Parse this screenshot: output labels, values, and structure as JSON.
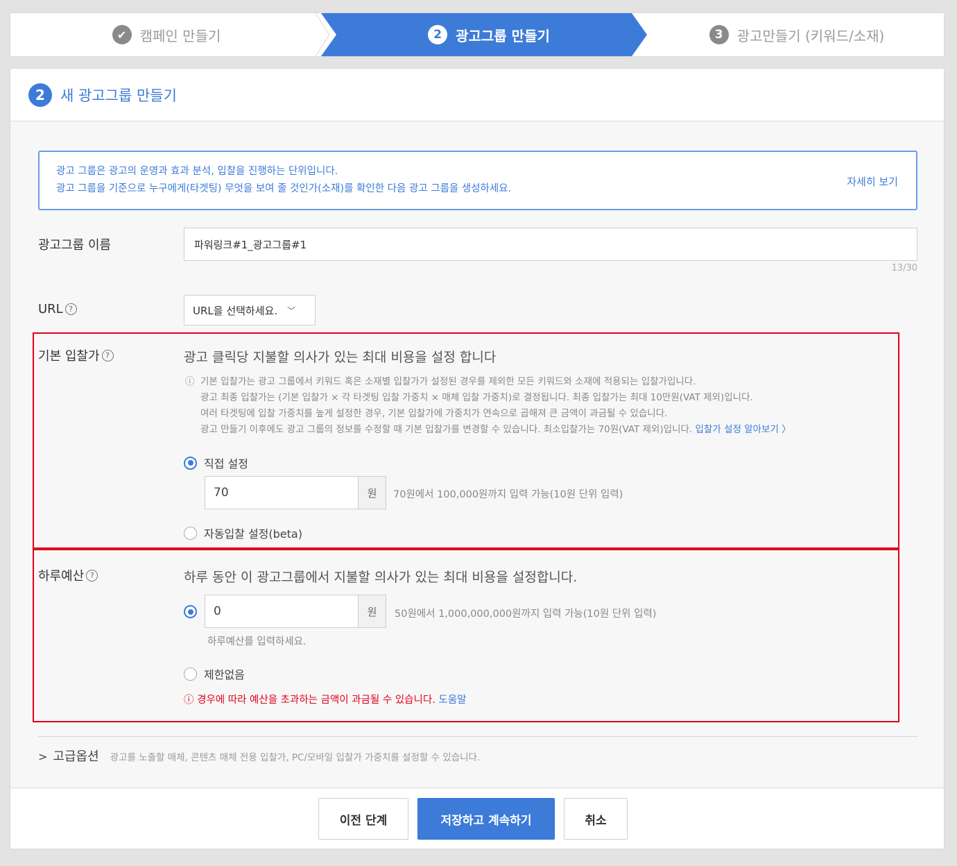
{
  "stepper": {
    "step1": {
      "label": "캠페인 만들기",
      "icon": "check-icon"
    },
    "step2": {
      "number": "2",
      "label": "광고그룹 만들기"
    },
    "step3": {
      "number": "3",
      "label": "광고만들기 (키워드/소재)"
    }
  },
  "panel": {
    "step_number": "2",
    "title": "새 광고그룹 만들기"
  },
  "info": {
    "line1": "광고 그룹은 광고의 운영과 효과 분석, 입찰을 진행하는 단위입니다.",
    "line2": "광고 그룹을 기준으로 누구에게(타겟팅) 무엇을 보여 줄 것인가(소재)를 확인한 다음 광고 그룹을 생성하세요.",
    "more_link": "자세히 보기"
  },
  "adgroup_name": {
    "label": "광고그룹 이름",
    "value": "파워링크#1_광고그룹#1",
    "counter": "13/30"
  },
  "url": {
    "label": "URL",
    "help_icon": "?",
    "select_value": "URL을 선택하세요."
  },
  "base_bid": {
    "label": "기본 입찰가",
    "help_icon": "?",
    "description": "광고 클릭당 지불할 의사가 있는 최대 비용을 설정 합니다",
    "note_icon": "ⓘ",
    "notes": [
      "기본 입찰가는 광고 그룹에서 키워드 혹은 소재별 입찰가가 설정된 경우를 제외한 모든 키워드와 소재에 적용되는 입찰가입니다.",
      "광고 최종 입찰가는 (기본 입찰가 × 각 타겟팅 입찰 가중치 × 매체 입찰 가중치)로 결정됩니다. 최종 입찰가는 최대 10만원(VAT 제외)입니다.",
      "여러 타겟팅에 입찰 가중치를 높게 설정한 경우, 기본 입찰가에 가중치가 연속으로 곱해져 큰 금액이 과금될 수 있습니다.",
      "광고 만들기 이후에도 광고 그룹의 정보를 수정할 때 기본 입찰가를 변경할 수 있습니다. 최소입찰가는 70원(VAT 제외)입니다."
    ],
    "learn_link": "입찰가 설정 알아보기 〉",
    "option_manual": "직접 설정",
    "value": "70",
    "unit": "원",
    "hint": "70원에서 100,000원까지 입력 가능(10원 단위 입력)",
    "option_auto": "자동입찰 설정(beta)"
  },
  "daily_budget": {
    "label": "하루예산",
    "help_icon": "?",
    "description": "하루 동안 이 광고그룹에서 지불할 의사가 있는 최대 비용을 설정합니다.",
    "value": "0",
    "unit": "원",
    "hint": "50원에서 1,000,000,000원까지 입력 가능(10원 단위 입력)",
    "sub_hint": "하루예산를 입력하세요.",
    "option_unlimited": "제한없음",
    "warning_icon": "ⓘ",
    "warning": "경우에 따라 예산을 초과하는 금액이 과금될 수 있습니다.",
    "help_link": "도움말"
  },
  "advanced": {
    "arrow": ">",
    "title": "고급옵션",
    "description": "광고를 노출할 매체, 콘텐츠 매체 전용 입찰가, PC/모바일 입찰가 가중치를 설정할 수 있습니다."
  },
  "buttons": {
    "prev": "이전 단계",
    "save": "저장하고 계속하기",
    "cancel": "취소"
  },
  "colors": {
    "accent": "#3c7bd8",
    "highlight": "#e0001b"
  }
}
